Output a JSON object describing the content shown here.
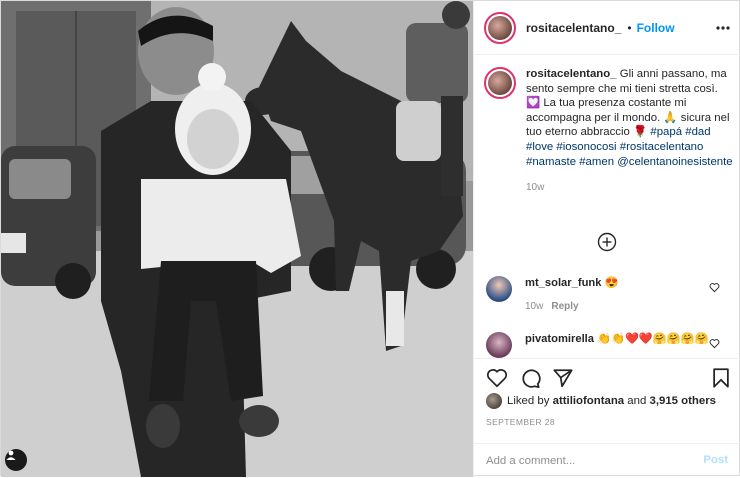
{
  "post": {
    "username": "rositacelentano_",
    "follow_label": "Follow",
    "separator": "•",
    "caption_text": "Gli anni passano, ma sento sempre che mi tieni stretta così. 💟 La tua presenza costante mi accompagna per il mondo. 🙏 sicura nel tuo eterno abbraccio 🌹",
    "hashtags": [
      "#papá",
      "#dad",
      "#love",
      "#iosonocosi",
      "#rositacelentano",
      "#namaste",
      "#amen"
    ],
    "mention": "@celentanoinesistente",
    "caption_time": "10w"
  },
  "comments": [
    {
      "username": "mt_solar_funk",
      "text": "😍",
      "time": "10w",
      "reply_label": "Reply"
    },
    {
      "username": "pivatomirella",
      "text": "👏👏❤️❤️🤗🤗🤗🤗"
    }
  ],
  "likes": {
    "prefix": "Liked by",
    "user": "attiliofontana",
    "joiner": "and",
    "others": "3,915 others"
  },
  "date": "SEPTEMBER 28",
  "add_comment": {
    "placeholder": "Add a comment...",
    "post_label": "Post"
  },
  "colors": {
    "follow": "#0095f6",
    "hashtag": "#00376b",
    "muted": "#8e8e8e",
    "post_disabled": "#b2dffc"
  },
  "icons": [
    "more-options-icon",
    "add-comments-icon",
    "like-icon",
    "comment-icon",
    "share-icon",
    "save-icon",
    "user-tag-icon"
  ]
}
